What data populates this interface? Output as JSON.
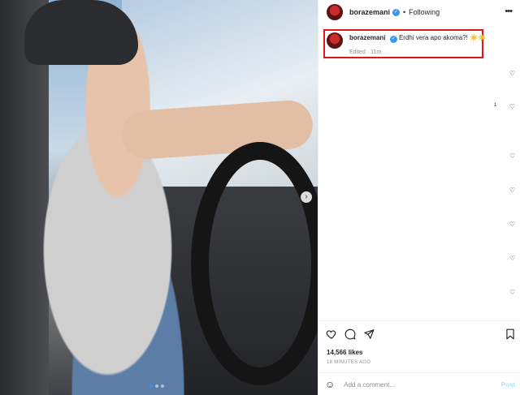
{
  "post": {
    "username": "borazemani",
    "follow_status": "Following",
    "bullet": "•",
    "more_icon": "more-horizontal-icon",
    "caption": {
      "username": "borazemani",
      "text": "Erdhi vera apo akoma?! ☀️☀️",
      "meta": "Edited · 11m"
    },
    "likes": "14,566 likes",
    "time_ago": "18 MINUTES AGO",
    "comment_placeholder": "Add a comment...",
    "post_label": "Post",
    "reply_count": "1",
    "carousel": {
      "dots": 3,
      "active_index": 0
    }
  },
  "colors": {
    "verified": "#3897f0",
    "highlight": "#e0161b",
    "post_button": "#b2dffc"
  }
}
